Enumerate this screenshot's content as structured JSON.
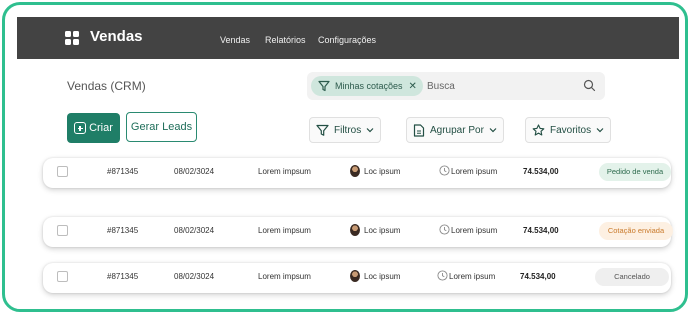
{
  "header": {
    "app_title": "Vendas",
    "nav": [
      "Vendas",
      "Relatórios",
      "Configurações"
    ]
  },
  "page": {
    "title": "Vendas (CRM)"
  },
  "search": {
    "active_filter": "Minhas cotações",
    "placeholder": "Busca"
  },
  "actions": {
    "create_label": "Criar",
    "generate_leads_label": "Gerar Leads"
  },
  "toolbar": {
    "filters_label": "Filtros",
    "group_by_label": "Agrupar Por",
    "favorites_label": "Favoritos"
  },
  "rows": [
    {
      "id": "#871345",
      "date": "08/02/3024",
      "description": "Lorem impsum",
      "owner": "Loc ipsum",
      "activity": "Lorem ipsum",
      "amount": "74.534,00",
      "status": "Pedido de venda"
    },
    {
      "id": "#871345",
      "date": "08/02/3024",
      "description": "Lorem impsum",
      "owner": "Loc ipsum",
      "activity": "Lorem ipsum",
      "amount": "74.534,00",
      "status": "Cotação enviada"
    },
    {
      "id": "#871345",
      "date": "08/02/3024",
      "description": "Lorem impsum",
      "owner": "Loc ipsum",
      "activity": "Lorem ipsum",
      "amount": "74.534,00",
      "status": "Cancelado"
    }
  ],
  "colors": {
    "accent": "#1f7e67",
    "frame": "#2fbf8f",
    "topbar": "#434343",
    "status_sale": "#e3f2ea",
    "status_sent": "#fdf0e2",
    "status_cancelled": "#efefef"
  }
}
